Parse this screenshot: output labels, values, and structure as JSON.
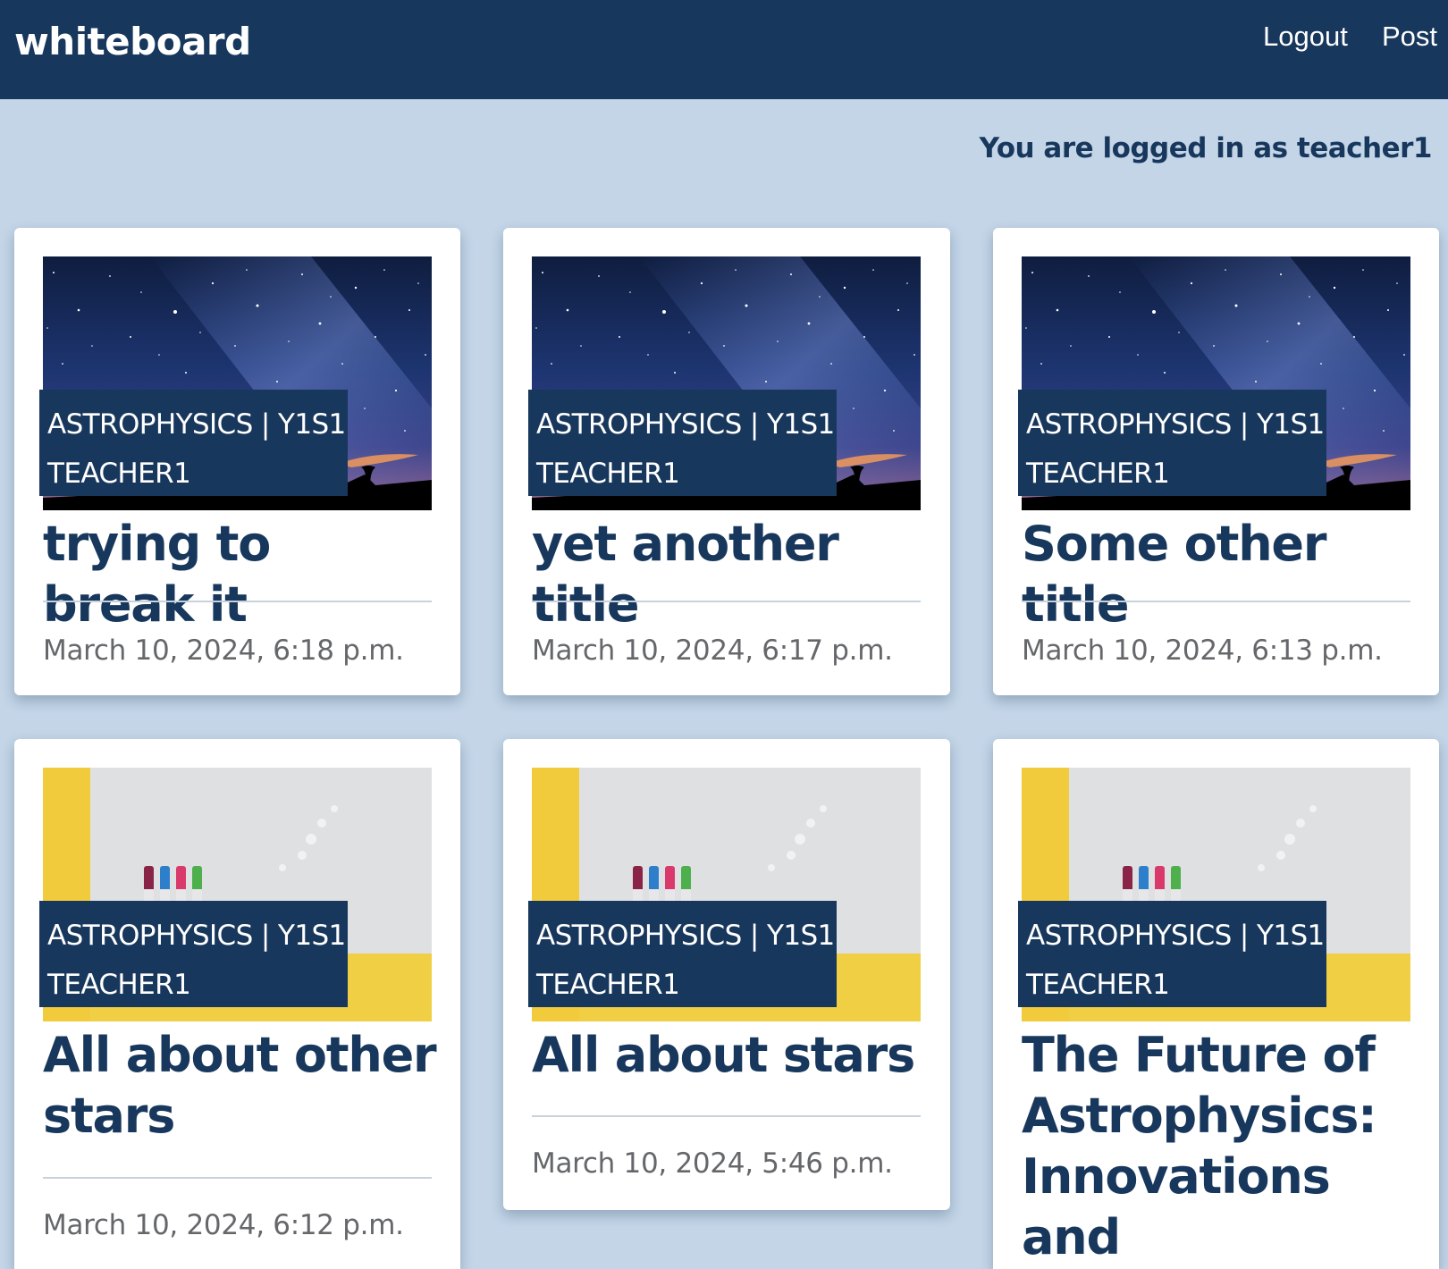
{
  "navbar": {
    "brand": "whiteboard",
    "links": [
      {
        "label": "Logout"
      },
      {
        "label": "Post"
      }
    ]
  },
  "status": {
    "text": "You are logged in as teacher1"
  },
  "posts": [
    {
      "category": "ASTROPHYSICS | Y1S1",
      "author": "TEACHER1",
      "title": "trying to break it",
      "date": "March 10, 2024, 6:18 p.m.",
      "image": "night-sky-image"
    },
    {
      "category": "ASTROPHYSICS | Y1S1",
      "author": "TEACHER1",
      "title": "yet another title",
      "date": "March 10, 2024, 6:17 p.m.",
      "image": "night-sky-image"
    },
    {
      "category": "ASTROPHYSICS | Y1S1",
      "author": "TEACHER1",
      "title": "Some other title",
      "date": "March 10, 2024, 6:13 p.m.",
      "image": "night-sky-image"
    },
    {
      "category": "ASTROPHYSICS | Y1S1",
      "author": "TEACHER1",
      "title": "All about other stars",
      "date": "March 10, 2024, 6:12 p.m.",
      "image": "whiteboard-markers-image"
    },
    {
      "category": "ASTROPHYSICS | Y1S1",
      "author": "TEACHER1",
      "title": "All about stars",
      "date": "March 10, 2024, 5:46 p.m.",
      "image": "whiteboard-markers-image"
    },
    {
      "category": "ASTROPHYSICS | Y1S1",
      "author": "TEACHER1",
      "title": "The Future of Astrophysics: Innovations and Discoveries",
      "date": "",
      "image": "whiteboard-markers-image"
    }
  ]
}
